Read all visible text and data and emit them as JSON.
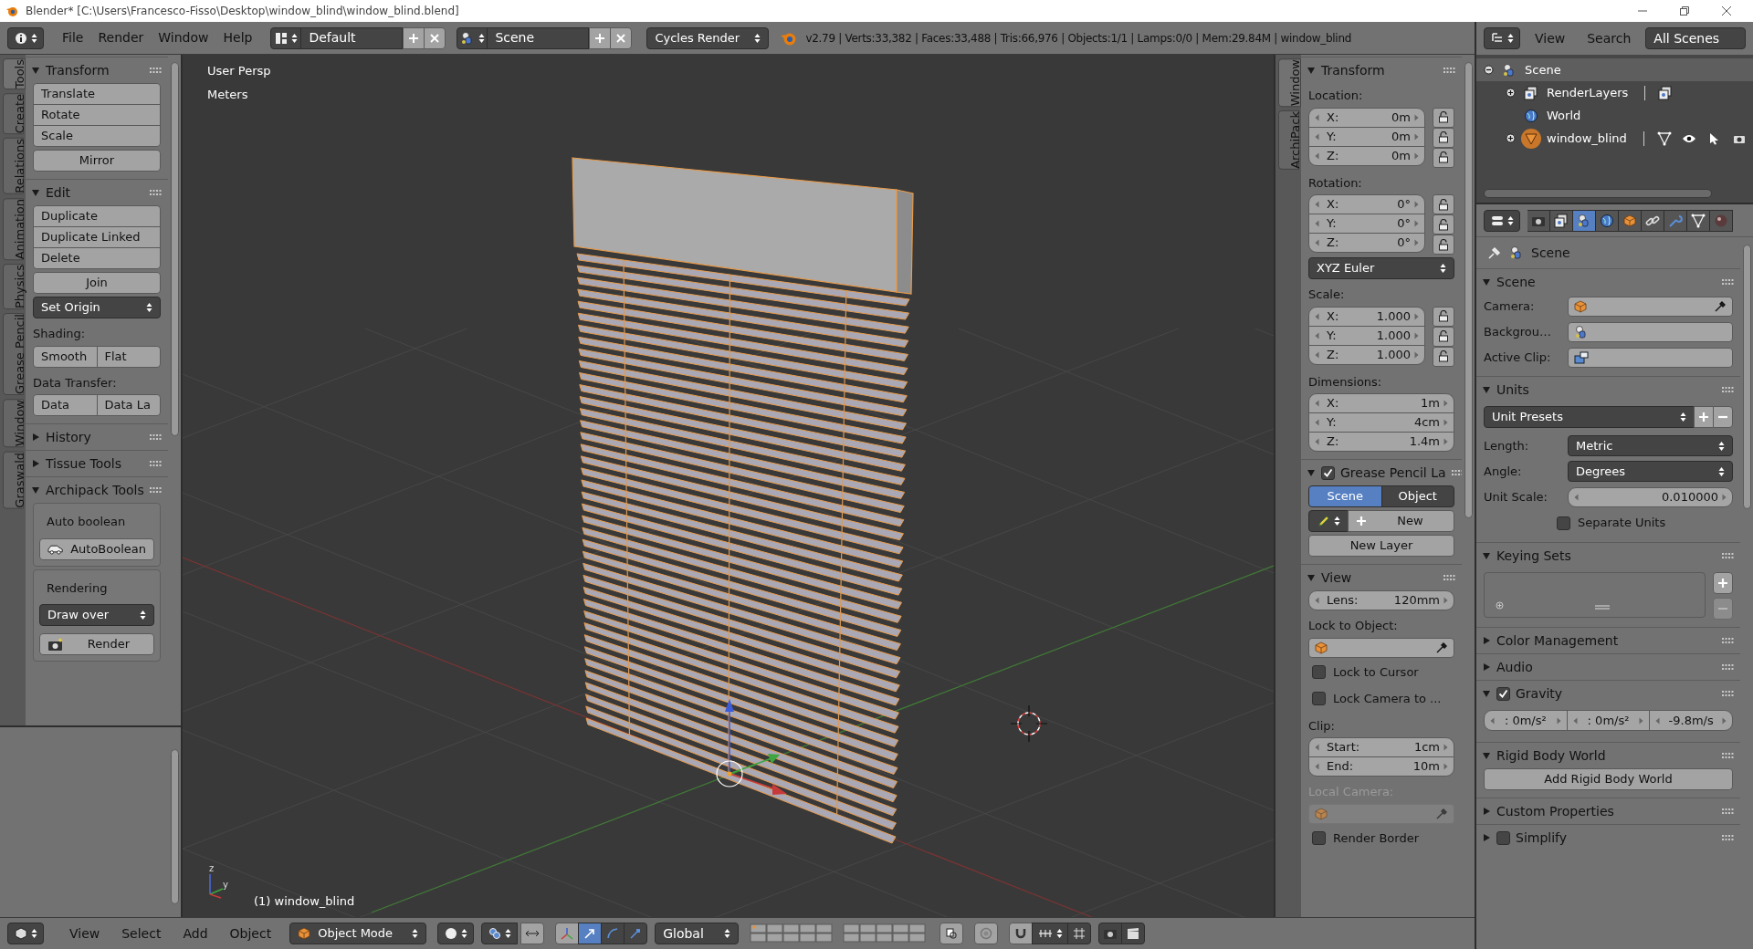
{
  "window": {
    "title": "Blender* [C:\\Users\\Francesco-Fisso\\Desktop\\window_blind\\window_blind.blend]"
  },
  "header": {
    "menus": [
      "File",
      "Render",
      "Window",
      "Help"
    ],
    "layout": "Default",
    "scene": "Scene",
    "engine": "Cycles Render",
    "stats": "v2.79 | Verts:33,382 | Faces:33,488 | Tris:66,976 | Objects:1/1 | Lamps:0/0 | Mem:29.84M | window_blind"
  },
  "tool_tabs": [
    {
      "label": "Tools",
      "selected": true
    },
    {
      "label": "Create",
      "selected": false
    },
    {
      "label": "Relations",
      "selected": false
    },
    {
      "label": "Animation",
      "selected": false
    },
    {
      "label": "Physics",
      "selected": false
    },
    {
      "label": "Grease Pencil",
      "selected": false
    },
    {
      "label": "Window",
      "selected": false
    },
    {
      "label": "Graswald",
      "selected": false
    }
  ],
  "tool_panels": [
    {
      "title": "Transform",
      "expanded": true,
      "items": [
        {
          "kind": "buttons",
          "labels": [
            "Translate",
            "Rotate",
            "Scale"
          ]
        },
        {
          "kind": "button",
          "label": "Mirror"
        }
      ]
    },
    {
      "title": "Edit",
      "expanded": true,
      "items": [
        {
          "kind": "buttons",
          "labels": [
            "Duplicate",
            "Duplicate Linked",
            "Delete"
          ]
        },
        {
          "kind": "button",
          "label": "Join"
        },
        {
          "kind": "dropdown",
          "label": "Set Origin"
        },
        {
          "kind": "label",
          "text": "Shading:"
        },
        {
          "kind": "row",
          "labels": [
            "Smooth",
            "Flat"
          ]
        },
        {
          "kind": "label",
          "text": "Data Transfer:"
        },
        {
          "kind": "row",
          "labels": [
            "Data",
            "Data La"
          ]
        }
      ]
    },
    {
      "title": "History",
      "expanded": false
    },
    {
      "title": "Tissue Tools",
      "expanded": false
    },
    {
      "title": "Archipack Tools",
      "expanded": true,
      "items": [
        {
          "kind": "box",
          "items": [
            {
              "kind": "label",
              "text": "Auto boolean"
            },
            {
              "kind": "car_button",
              "label": "AutoBoolean"
            }
          ]
        },
        {
          "kind": "box",
          "items": [
            {
              "kind": "label",
              "text": "Rendering"
            },
            {
              "kind": "dropdown",
              "label": "Draw over"
            },
            {
              "kind": "camera_button",
              "label": "Render"
            }
          ]
        }
      ]
    }
  ],
  "viewport": {
    "view": "User Persp",
    "units": "Meters",
    "object": "(1) window_blind",
    "axis_labels": [
      "z",
      "y"
    ]
  },
  "sidebar_tabs": [
    {
      "label": "Window",
      "selected": true
    },
    {
      "label": "ArchiPack",
      "selected": false
    }
  ],
  "sidebar_panels": [
    {
      "title": "Transform",
      "expanded": true,
      "items": [
        {
          "kind": "label",
          "text": "Location:"
        },
        {
          "kind": "vector",
          "locks": true,
          "fields": [
            {
              "label": "X:",
              "value": "0m"
            },
            {
              "label": "Y:",
              "value": "0m"
            },
            {
              "label": "Z:",
              "value": "0m"
            }
          ]
        },
        {
          "kind": "label",
          "text": "Rotation:"
        },
        {
          "kind": "vector",
          "locks": true,
          "fields": [
            {
              "label": "X:",
              "value": "0°"
            },
            {
              "label": "Y:",
              "value": "0°"
            },
            {
              "label": "Z:",
              "value": "0°"
            }
          ]
        },
        {
          "kind": "dropdown",
          "label": "XYZ Euler"
        },
        {
          "kind": "label",
          "text": "Scale:"
        },
        {
          "kind": "vector",
          "locks": true,
          "fields": [
            {
              "label": "X:",
              "value": "1.000"
            },
            {
              "label": "Y:",
              "value": "1.000"
            },
            {
              "label": "Z:",
              "value": "1.000"
            }
          ]
        },
        {
          "kind": "label",
          "text": "Dimensions:"
        },
        {
          "kind": "vector",
          "locks": false,
          "fields": [
            {
              "label": "X:",
              "value": "1m"
            },
            {
              "label": "Y:",
              "value": "4cm"
            },
            {
              "label": "Z:",
              "value": "1.4m"
            }
          ]
        }
      ]
    },
    {
      "title": "Grease Pencil La",
      "expanded": true,
      "checked": true,
      "items": [
        {
          "kind": "toggle_row",
          "options": [
            {
              "label": "Scene",
              "selected": true
            },
            {
              "label": "Object",
              "selected": false
            }
          ]
        },
        {
          "kind": "pencil_new",
          "label": "New"
        },
        {
          "kind": "button",
          "label": "New Layer"
        }
      ]
    },
    {
      "title": "View",
      "expanded": true,
      "items": [
        {
          "kind": "number",
          "label": "Lens:",
          "value": "120mm"
        },
        {
          "kind": "label",
          "text": "Lock to Object:",
          "disabled": false
        },
        {
          "kind": "object_field",
          "disabled": false
        },
        {
          "kind": "checkbox",
          "label": "Lock to Cursor",
          "checked": false
        },
        {
          "kind": "checkbox",
          "label": "Lock Camera to ...",
          "checked": false
        },
        {
          "kind": "label",
          "text": "Clip:",
          "disabled": false
        },
        {
          "kind": "vector",
          "locks": false,
          "fields": [
            {
              "label": "Start:",
              "value": "1cm"
            },
            {
              "label": "End:",
              "value": "10m"
            }
          ]
        },
        {
          "kind": "label",
          "text": "Local Camera:",
          "disabled": true
        },
        {
          "kind": "object_field",
          "disabled": true
        },
        {
          "kind": "checkbox",
          "label": "Render Border",
          "checked": false
        }
      ]
    }
  ],
  "outliner": {
    "menus": [
      "View",
      "Search"
    ],
    "filter": "All Scenes",
    "tree": [
      {
        "kind": "scene",
        "label": "Scene",
        "selected": true,
        "active": false,
        "expanded": true,
        "children": [
          {
            "kind": "render_layers",
            "label": "RenderLayers",
            "selected": false,
            "active": false,
            "expanded": false
          },
          {
            "kind": "world",
            "label": "World",
            "selected": false,
            "active": false
          },
          {
            "kind": "mesh_object",
            "label": "window_blind",
            "selected": false,
            "active": true,
            "expanded": false
          }
        ]
      }
    ]
  },
  "properties": {
    "tabs": [
      {
        "kind": "render",
        "selected": false
      },
      {
        "kind": "render_layers",
        "selected": false
      },
      {
        "kind": "scene",
        "selected": true
      },
      {
        "kind": "world",
        "selected": false
      },
      {
        "kind": "object",
        "selected": false
      },
      {
        "kind": "constraints",
        "selected": false
      },
      {
        "kind": "modifiers",
        "selected": false
      },
      {
        "kind": "data",
        "selected": false
      },
      {
        "kind": "material",
        "selected": false
      }
    ],
    "context": "Scene",
    "panels": [
      {
        "title": "Scene",
        "expanded": true,
        "items": [
          {
            "kind": "camera_field",
            "label": "Camera:"
          },
          {
            "kind": "scene_field",
            "label": "Backgrou…"
          },
          {
            "kind": "clip_field",
            "label": "Active Clip:"
          }
        ]
      },
      {
        "title": "Units",
        "expanded": true,
        "items": [
          {
            "kind": "preset",
            "label": "Unit Presets"
          },
          {
            "kind": "labeled_dropdown",
            "label": "Length:",
            "value": "Metric"
          },
          {
            "kind": "labeled_dropdown",
            "label": "Angle:",
            "value": "Degrees"
          },
          {
            "kind": "labeled_number",
            "label": "Unit Scale:",
            "value": "0.010000"
          },
          {
            "kind": "indented_checkbox",
            "label": "Separate Units",
            "checked": false
          }
        ]
      },
      {
        "title": "Keying Sets",
        "expanded": true,
        "items": [
          {
            "kind": "list_box"
          }
        ]
      },
      {
        "title": "Color Management",
        "expanded": false
      },
      {
        "title": "Audio",
        "expanded": false
      },
      {
        "title": "Gravity",
        "expanded": true,
        "checked": true,
        "items": [
          {
            "kind": "triple",
            "values": [
              ": 0m/s²",
              ": 0m/s²",
              "-9.8m/s"
            ]
          }
        ]
      },
      {
        "title": "Rigid Body World",
        "expanded": true,
        "items": [
          {
            "kind": "button",
            "label": "Add Rigid Body World"
          }
        ]
      },
      {
        "title": "Custom Properties",
        "expanded": false
      },
      {
        "title": "Simplify",
        "expanded": false,
        "checked": false
      }
    ]
  },
  "bottom_bar": {
    "menus": [
      "View",
      "Select",
      "Add",
      "Object"
    ],
    "mode": "Object Mode",
    "orientation": "Global"
  }
}
